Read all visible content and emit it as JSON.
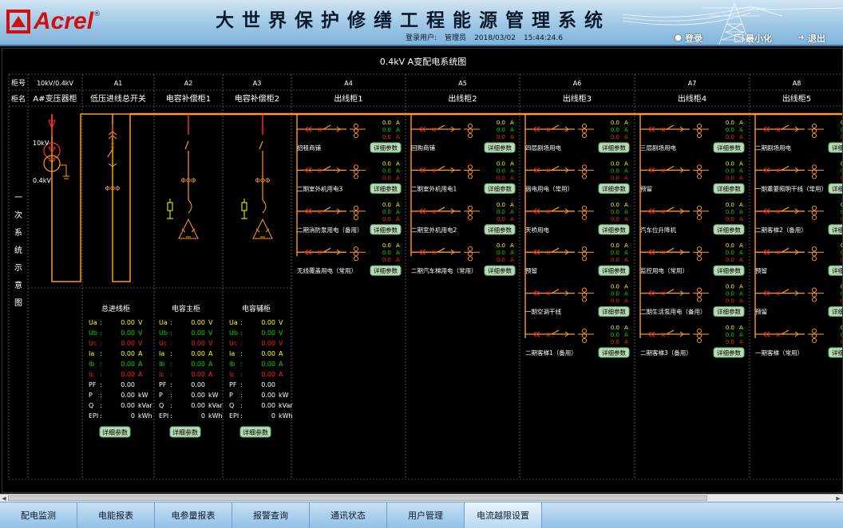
{
  "header": {
    "logo_text": "Acrel",
    "logo_reg": "®",
    "title": "大世界保护修缮工程能源管理系统",
    "login_label": "登录用户:",
    "login_user": "管理员",
    "date": "2018/03/02",
    "time": "15:44:24.6",
    "btn_login": "登录",
    "btn_minimize": "最小化",
    "btn_exit": "退出"
  },
  "diagram": {
    "title": "0.4kV A变配电系统图",
    "row_labels": {
      "cabinet_no": "柜号",
      "cabinet_name": "柜名"
    },
    "side_label": [
      "一",
      "次",
      "系",
      "统",
      "示",
      "意",
      "图"
    ],
    "columns": [
      {
        "no": "10kV/0.4kV",
        "name": "A#变压器柜"
      },
      {
        "no": "A1",
        "name": "低压进线总开关"
      },
      {
        "no": "A2",
        "name": "电容补偿柜1"
      },
      {
        "no": "A3",
        "name": "电容补偿柜2"
      },
      {
        "no": "A4",
        "name": "出线柜1"
      },
      {
        "no": "A5",
        "name": "出线柜2"
      },
      {
        "no": "A6",
        "name": "出线柜3"
      },
      {
        "no": "A7",
        "name": "出线柜4"
      },
      {
        "no": "A8",
        "name": "出线柜5"
      }
    ],
    "transformer": {
      "hv": "10kV",
      "lv": "0.4kV"
    },
    "meters": [
      {
        "title": "总进线柜",
        "btn": "详细参数",
        "rows": [
          {
            "label": "Ua",
            "value": "0.00",
            "unit": "V",
            "color": "#ffff00"
          },
          {
            "label": "Ub",
            "value": "0.00",
            "unit": "V",
            "color": "#00dd00"
          },
          {
            "label": "Uc",
            "value": "0.00",
            "unit": "V",
            "color": "#ff2020"
          },
          {
            "label": "Ia",
            "value": "0.00",
            "unit": "A",
            "color": "#ffff00"
          },
          {
            "label": "Ib",
            "value": "0.00",
            "unit": "A",
            "color": "#00dd00"
          },
          {
            "label": "Ic",
            "value": "0.00",
            "unit": "A",
            "color": "#ff2020"
          },
          {
            "label": "PF",
            "value": "0.00",
            "unit": "",
            "color": "#ffffff"
          },
          {
            "label": "P",
            "value": "0.00",
            "unit": "kW",
            "color": "#ffffff"
          },
          {
            "label": "Q",
            "value": "0.00",
            "unit": "kVar",
            "color": "#ffffff"
          },
          {
            "label": "EPI",
            "value": "0",
            "unit": "kWh",
            "color": "#ffffff"
          }
        ]
      },
      {
        "title": "电容主柜",
        "btn": "详细参数",
        "rows": [
          {
            "label": "Ua",
            "value": "0.00",
            "unit": "V",
            "color": "#ffff00"
          },
          {
            "label": "Ub",
            "value": "0.00",
            "unit": "V",
            "color": "#00dd00"
          },
          {
            "label": "Uc",
            "value": "0.00",
            "unit": "V",
            "color": "#ff2020"
          },
          {
            "label": "Ia",
            "value": "0.00",
            "unit": "A",
            "color": "#ffff00"
          },
          {
            "label": "Ib",
            "value": "0.00",
            "unit": "A",
            "color": "#00dd00"
          },
          {
            "label": "Ic",
            "value": "0.00",
            "unit": "A",
            "color": "#ff2020"
          },
          {
            "label": "PF",
            "value": "0.00",
            "unit": "",
            "color": "#ffffff"
          },
          {
            "label": "P",
            "value": "0.00",
            "unit": "kW",
            "color": "#ffffff"
          },
          {
            "label": "Q",
            "value": "0.00",
            "unit": "kVar",
            "color": "#ffffff"
          },
          {
            "label": "EPI",
            "value": "0",
            "unit": "kWh",
            "color": "#ffffff"
          }
        ]
      },
      {
        "title": "电容辅柜",
        "btn": "详细参数",
        "rows": [
          {
            "label": "Ua",
            "value": "0.00",
            "unit": "V",
            "color": "#ffff00"
          },
          {
            "label": "Ub",
            "value": "0.00",
            "unit": "V",
            "color": "#00dd00"
          },
          {
            "label": "Uc",
            "value": "0.00",
            "unit": "V",
            "color": "#ff2020"
          },
          {
            "label": "Ia",
            "value": "0.00",
            "unit": "A",
            "color": "#ffff00"
          },
          {
            "label": "Ib",
            "value": "0.00",
            "unit": "A",
            "color": "#00dd00"
          },
          {
            "label": "Ic",
            "value": "0.00",
            "unit": "A",
            "color": "#ff2020"
          },
          {
            "label": "PF",
            "value": "0.00",
            "unit": "",
            "color": "#ffffff"
          },
          {
            "label": "P",
            "value": "0.00",
            "unit": "kW",
            "color": "#ffffff"
          },
          {
            "label": "Q",
            "value": "0.00",
            "unit": "kVar",
            "color": "#ffffff"
          },
          {
            "label": "EPI",
            "value": "0",
            "unit": "kWh",
            "color": "#ffffff"
          }
        ]
      }
    ],
    "feeder_values": {
      "a": "0.0",
      "b": "0.0",
      "c": "0.0",
      "unit": "A"
    },
    "detail_btn": "详细参数",
    "feeder_groups": [
      {
        "cabinet": "A4",
        "feeders": [
          "招租商铺",
          "二期室外机用电3",
          "二期消防泵用电（备用）",
          "无线覆盖用电（常用）"
        ]
      },
      {
        "cabinet": "A5",
        "feeders": [
          "回购商铺",
          "二期室外机用电1",
          "二期室外机用电2",
          "二期汽车梯用电（常用）"
        ]
      },
      {
        "cabinet": "A6",
        "feeders": [
          "四层剧场用电",
          "弱电用电（常用）",
          "天桥用电",
          "预留",
          "一期空调干线",
          "二期客梯1（备用）"
        ]
      },
      {
        "cabinet": "A7",
        "feeders": [
          "三层剧场用电",
          "预留",
          "汽车位升降机",
          "监控用电（常用）",
          "二期生活泵用电（备用）",
          "二期客梯3（备用）"
        ]
      },
      {
        "cabinet": "A8",
        "feeders": [
          "二期剧场用电",
          "一期重要照明干线（常用）",
          "二期客梯2（备用）",
          "预留",
          "预留",
          "一期客梯（常用）"
        ]
      }
    ],
    "colors": {
      "bus": "#ff9a1a",
      "breaker": "#ff3030",
      "label": "#ffffff",
      "grid": "#8a8a8a"
    }
  },
  "tabs": [
    {
      "label": "配电监测",
      "active": false
    },
    {
      "label": "电能报表",
      "active": false
    },
    {
      "label": "电参量报表",
      "active": false
    },
    {
      "label": "报警查询",
      "active": false
    },
    {
      "label": "通讯状态",
      "active": false
    },
    {
      "label": "用户管理",
      "active": false
    },
    {
      "label": "电流越限设置",
      "active": true
    }
  ]
}
